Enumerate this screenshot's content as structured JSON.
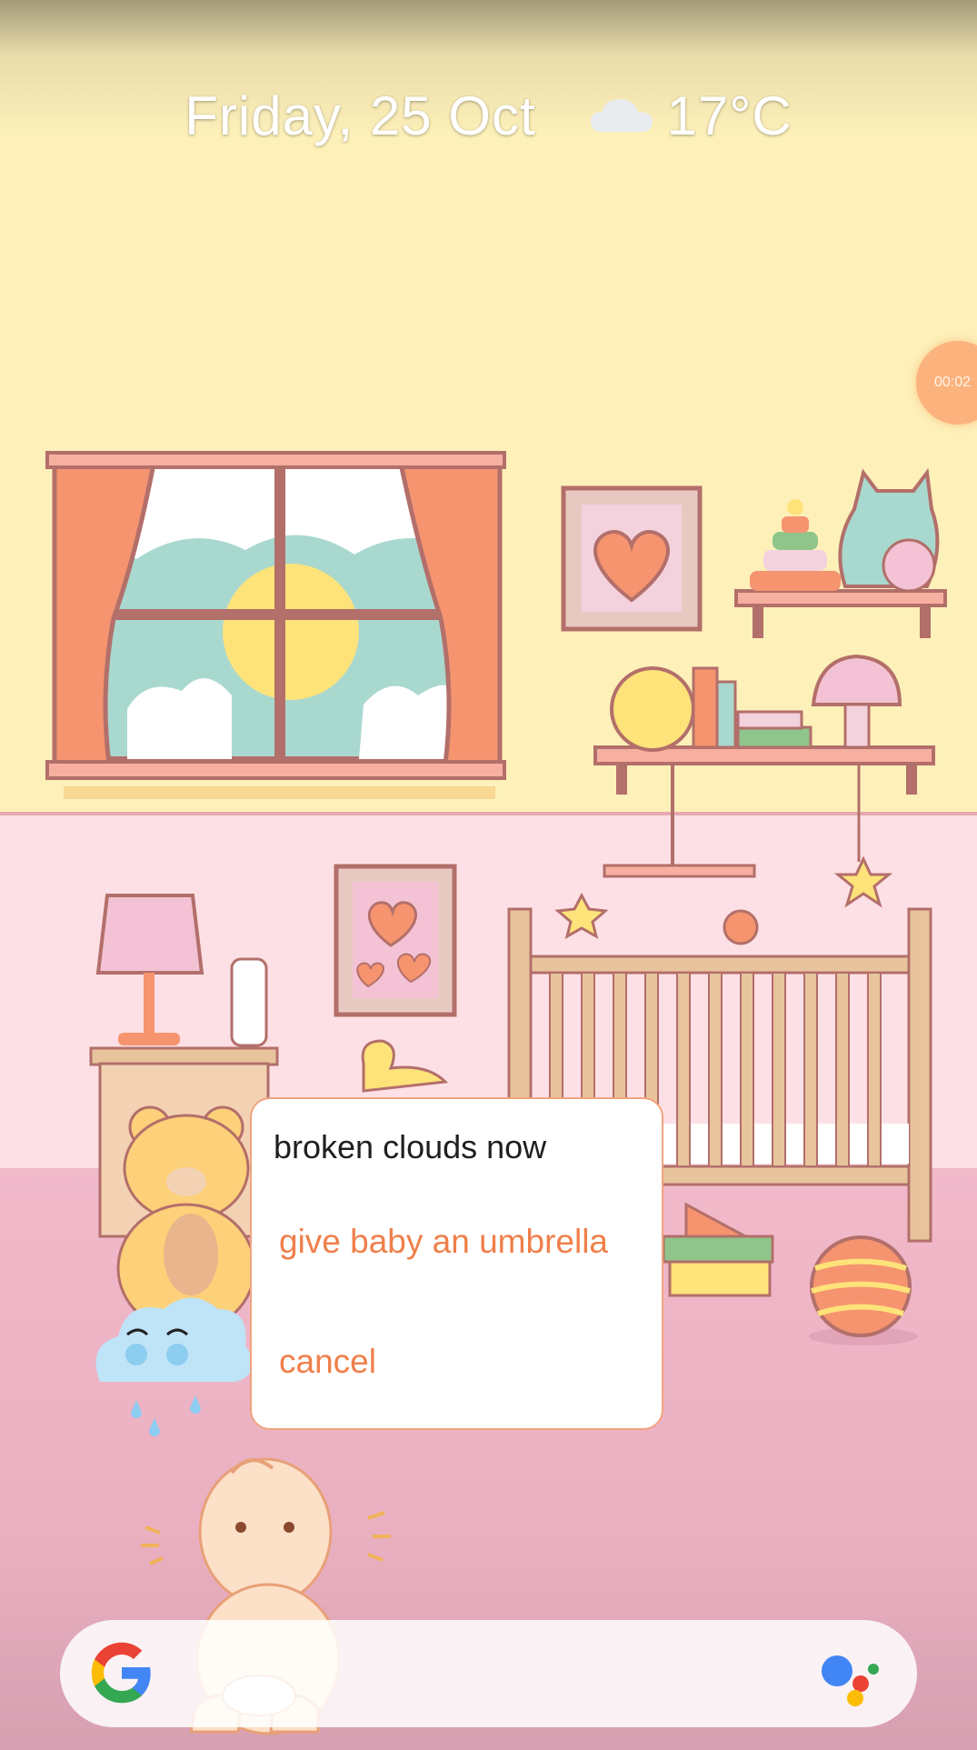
{
  "glance": {
    "date": "Friday, 25 Oct",
    "weather_icon": "cloud-icon",
    "temperature": "17°C"
  },
  "timer_bubble": {
    "text": "00:02"
  },
  "dialog": {
    "message": "broken clouds now",
    "actions": [
      {
        "label": "give baby an umbrella"
      },
      {
        "label": "cancel"
      }
    ]
  },
  "search_bar": {
    "logo_icon": "google-g-icon",
    "assistant_icon": "google-assistant-icon"
  },
  "colors": {
    "accent": "#ef7f4a",
    "dialog_border": "#f1a37e",
    "wall_top": "#fdf0b9",
    "wall_bottom": "#fde0e6",
    "floor": "#eab0c1"
  }
}
